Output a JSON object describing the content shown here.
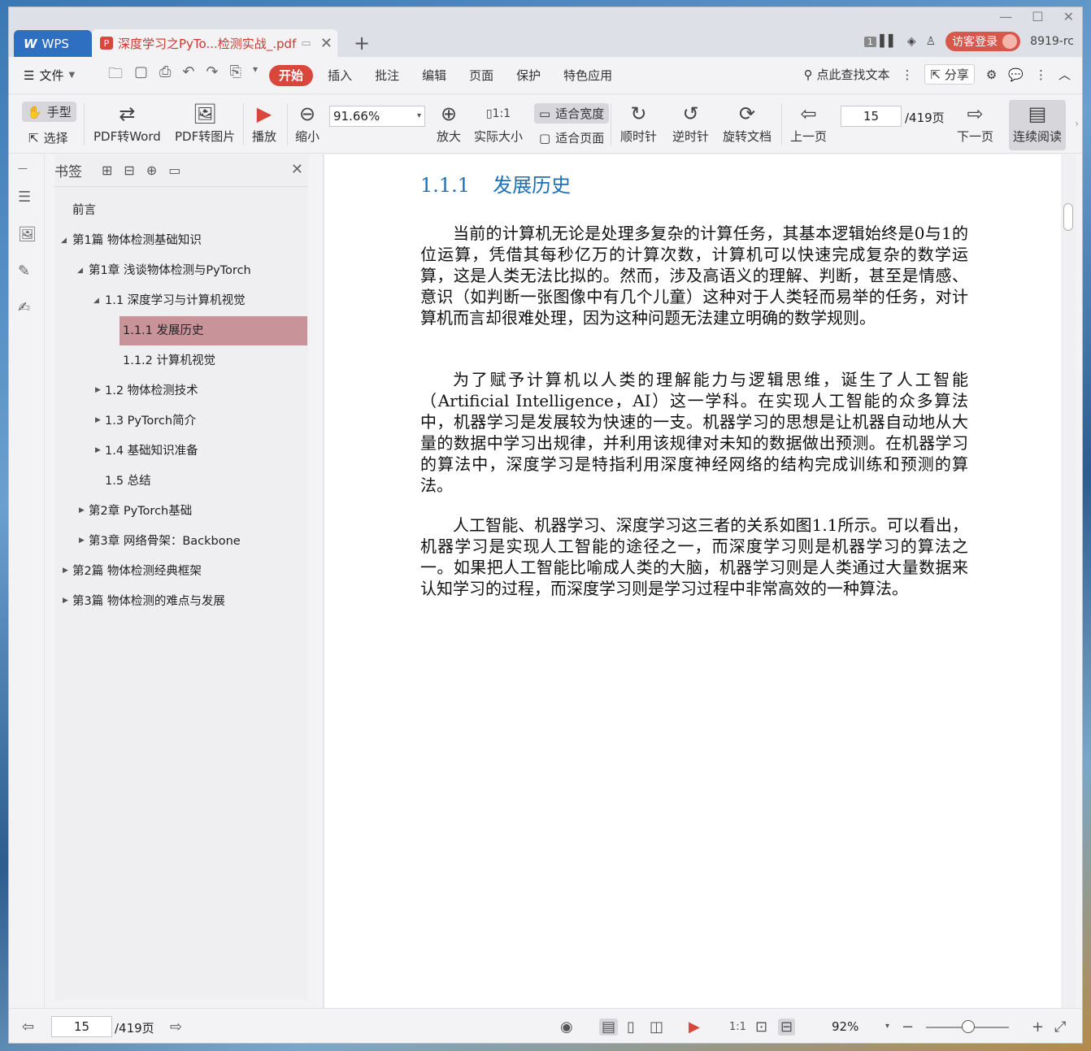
{
  "titlebar": {
    "wps_tab_label": "WPS",
    "doc_tab_label": "深度学习之PyTo...检测实战_.pdf",
    "pdf_badge": "P",
    "badge_count": "1",
    "login_label": "访客登录",
    "user_id": "8919-rc"
  },
  "menubar": {
    "file_label": "文件",
    "tabs": [
      "开始",
      "插入",
      "批注",
      "编辑",
      "页面",
      "保护",
      "特色应用"
    ],
    "search_label": "点此查找文本",
    "share_label": "分享"
  },
  "toolbar": {
    "hand_label": "手型",
    "select_label": "选择",
    "pdf_to_word": "PDF转Word",
    "pdf_to_image": "PDF转图片",
    "play_label": "播放",
    "zoom_out_label": "缩小",
    "zoom_value": "91.66%",
    "zoom_in_label": "放大",
    "actual_size_label": "实际大小",
    "fit_width_label": "适合宽度",
    "fit_page_label": "适合页面",
    "clockwise_label": "顺时针",
    "counter_clockwise_label": "逆时针",
    "rotate_doc_label": "旋转文档",
    "prev_page_label": "上一页",
    "page_value": "15",
    "page_total": "/419页",
    "next_page_label": "下一页",
    "continuous_label": "连续阅读"
  },
  "bookmarks": {
    "title": "书签",
    "items": [
      {
        "label": "前言"
      },
      {
        "label": "第1篇 物体检测基础知识"
      },
      {
        "label": "第1章 浅谈物体检测与PyTorch"
      },
      {
        "label": "1.1 深度学习与计算机视觉"
      },
      {
        "label": "1.1.1 发展历史"
      },
      {
        "label": "1.1.2 计算机视觉"
      },
      {
        "label": "1.2 物体检测技术"
      },
      {
        "label": "1.3 PyTorch简介"
      },
      {
        "label": "1.4 基础知识准备"
      },
      {
        "label": "1.5 总结"
      },
      {
        "label": "第2章 PyTorch基础"
      },
      {
        "label": "第3章 网络骨架：Backbone"
      },
      {
        "label": "第2篇 物体检测经典框架"
      },
      {
        "label": "第3篇 物体检测的难点与发展"
      }
    ]
  },
  "document": {
    "heading_number": "1.1.1",
    "heading_title": "发展历史",
    "paragraphs": [
      "当前的计算机无论是处理多复杂的计算任务，其基本逻辑始终是0与1的位运算，凭借其每秒亿万的计算次数，计算机可以快速完成复杂的数学运算，这是人类无法比拟的。然而，涉及高语义的理解、判断，甚至是情感、意识（如判断一张图像中有几个儿童）这种对于人类轻而易举的任务，对计算机而言却很难处理，因为这种问题无法建立明确的数学规则。",
      "为了赋予计算机以人类的理解能力与逻辑思维，诞生了人工智能（Artificial Intelligence，AI）这一学科。在实现人工智能的众多算法中，机器学习是发展较为快速的一支。机器学习的思想是让机器自动地从大量的数据中学习出规律，并利用该规律对未知的数据做出预测。在机器学习的算法中，深度学习是特指利用深度神经网络的结构完成训练和预测的算法。",
      "人工智能、机器学习、深度学习这三者的关系如图1.1所示。可以看出，机器学习是实现人工智能的途径之一，而深度学习则是机器学习的算法之一。如果把人工智能比喻成人类的大脑，机器学习则是人类通过大量数据来认知学习的过程，而深度学习则是学习过程中非常高效的一种算法。"
    ]
  },
  "statusbar": {
    "page_value": "15",
    "page_total": "/419页",
    "zoom_value": "92%"
  }
}
